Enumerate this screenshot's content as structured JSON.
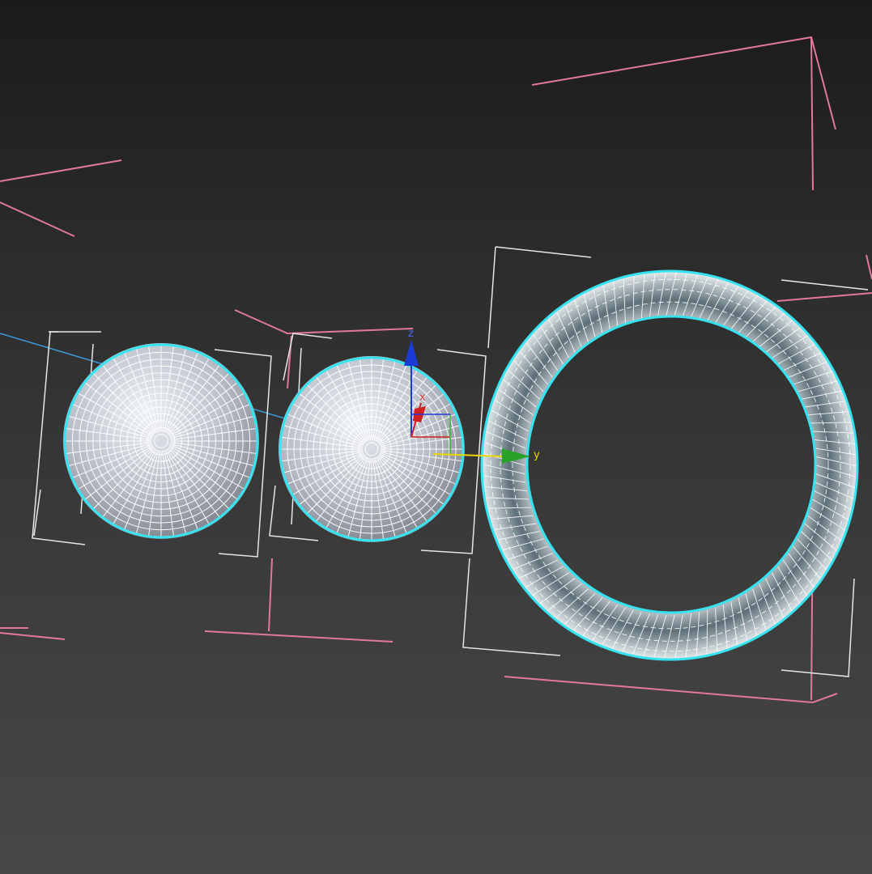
{
  "viewport": {
    "background_top": "#1b1b1b",
    "background_bottom": "#474747",
    "wire_color": "#ffffff",
    "selection_color": "#35e3f0",
    "light_helper_color": "#e2789b",
    "view_line_color": "#3a9ad8"
  },
  "objects": [
    {
      "type": "sphere",
      "state": "selected",
      "icon": "sphere-wireframe-icon"
    },
    {
      "type": "sphere",
      "state": "selected",
      "icon": "sphere-wireframe-icon"
    },
    {
      "type": "torus",
      "state": "selected",
      "icon": "torus-wireframe-icon"
    }
  ],
  "gizmo": {
    "mode": "move",
    "axes": [
      {
        "name": "x",
        "label": "x",
        "color": "#d21f1f"
      },
      {
        "name": "y",
        "label": "y",
        "color": "#e8d800"
      },
      {
        "name": "z",
        "label": "z",
        "color": "#1a3bd6"
      }
    ]
  }
}
